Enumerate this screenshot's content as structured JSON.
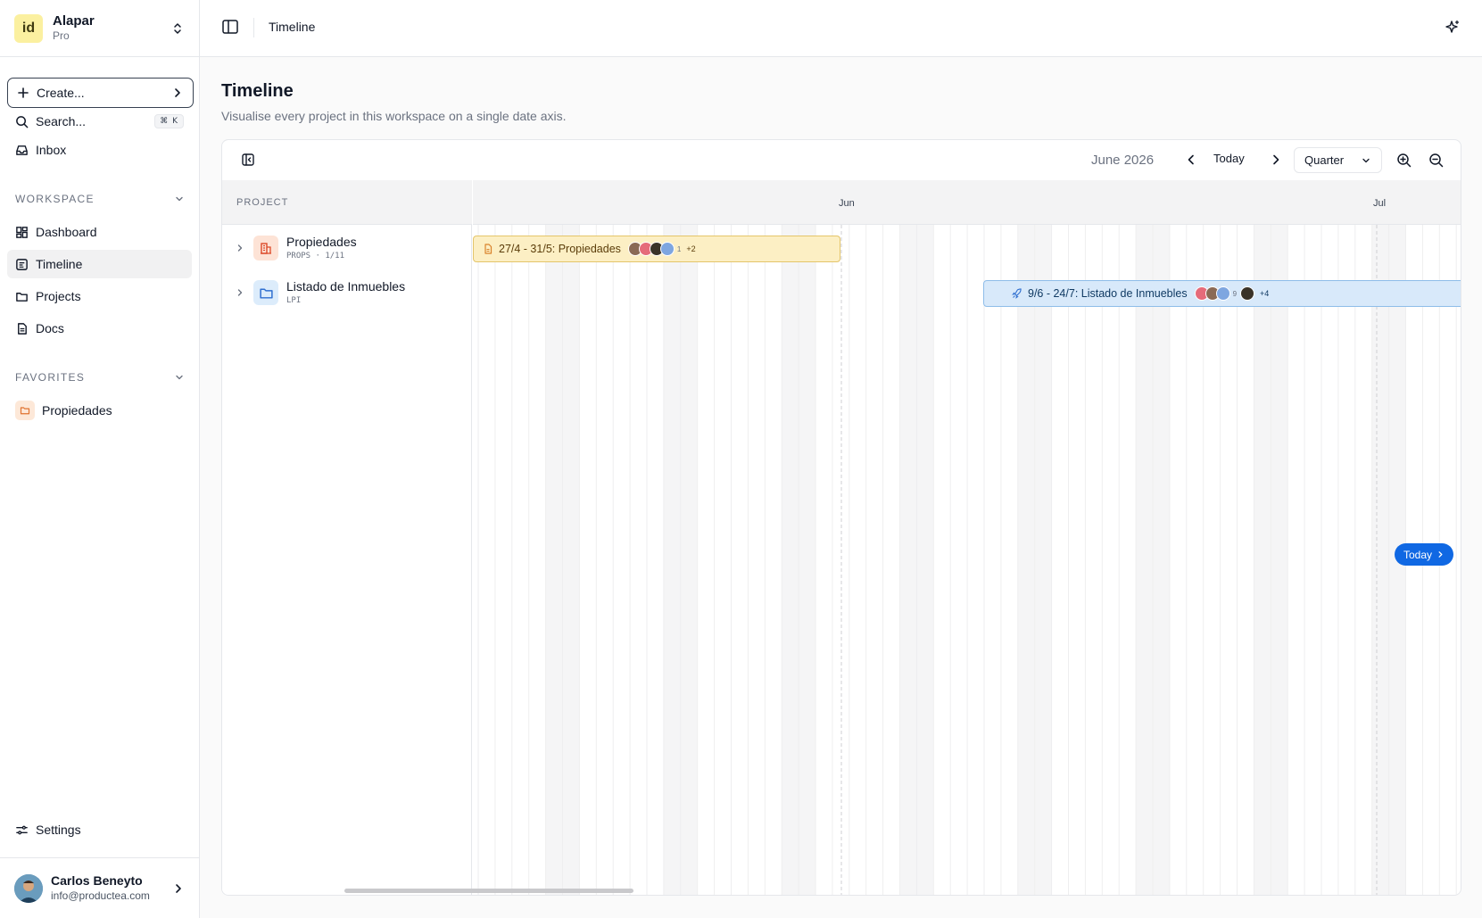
{
  "workspace": {
    "initials": "id",
    "name": "Alapar",
    "plan": "Pro"
  },
  "sidebar": {
    "create_label": "Create...",
    "search_label": "Search...",
    "search_shortcut": "⌘ K",
    "inbox_label": "Inbox",
    "workspace_header": "WORKSPACE",
    "nav": [
      {
        "label": "Dashboard",
        "icon": "dashboard-icon"
      },
      {
        "label": "Timeline",
        "icon": "timeline-icon",
        "active": true
      },
      {
        "label": "Projects",
        "icon": "projects-icon"
      },
      {
        "label": "Docs",
        "icon": "docs-icon"
      }
    ],
    "favorites_header": "FAVORITES",
    "favorites": [
      {
        "label": "Propiedades",
        "icon": "folder-icon"
      }
    ],
    "settings_label": "Settings"
  },
  "user": {
    "name": "Carlos Beneyto",
    "email": "info@productea.com"
  },
  "topbar": {
    "title": "Timeline"
  },
  "page": {
    "title": "Timeline",
    "subtitle": "Visualise every project in this workspace on a single date axis."
  },
  "timeline": {
    "current_month": "June 2026",
    "today_label": "Today",
    "zoom_select": "Quarter",
    "project_col_header": "PROJECT",
    "months": [
      "Jun",
      "Jul"
    ],
    "projects": [
      {
        "name": "Propiedades",
        "meta": "PROPS · 1/11",
        "icon": "building-icon"
      },
      {
        "name": "Listado de Inmuebles",
        "meta": "LPI",
        "icon": "folder-icon"
      }
    ],
    "bars": [
      {
        "label": "27/4 - 31/5: Propiedades",
        "icon": "document-icon",
        "count": "1",
        "more": "+2"
      },
      {
        "label": "9/6 - 24/7: Listado de Inmuebles",
        "icon": "rocket-icon",
        "count": "9",
        "more": "+4"
      }
    ],
    "today_pill": "Today"
  },
  "colors": {
    "accent": "#1068e3",
    "bar_a": "#fcefc4",
    "bar_b": "#d8e9fa",
    "workspace_logo": "#fbf0a0"
  }
}
